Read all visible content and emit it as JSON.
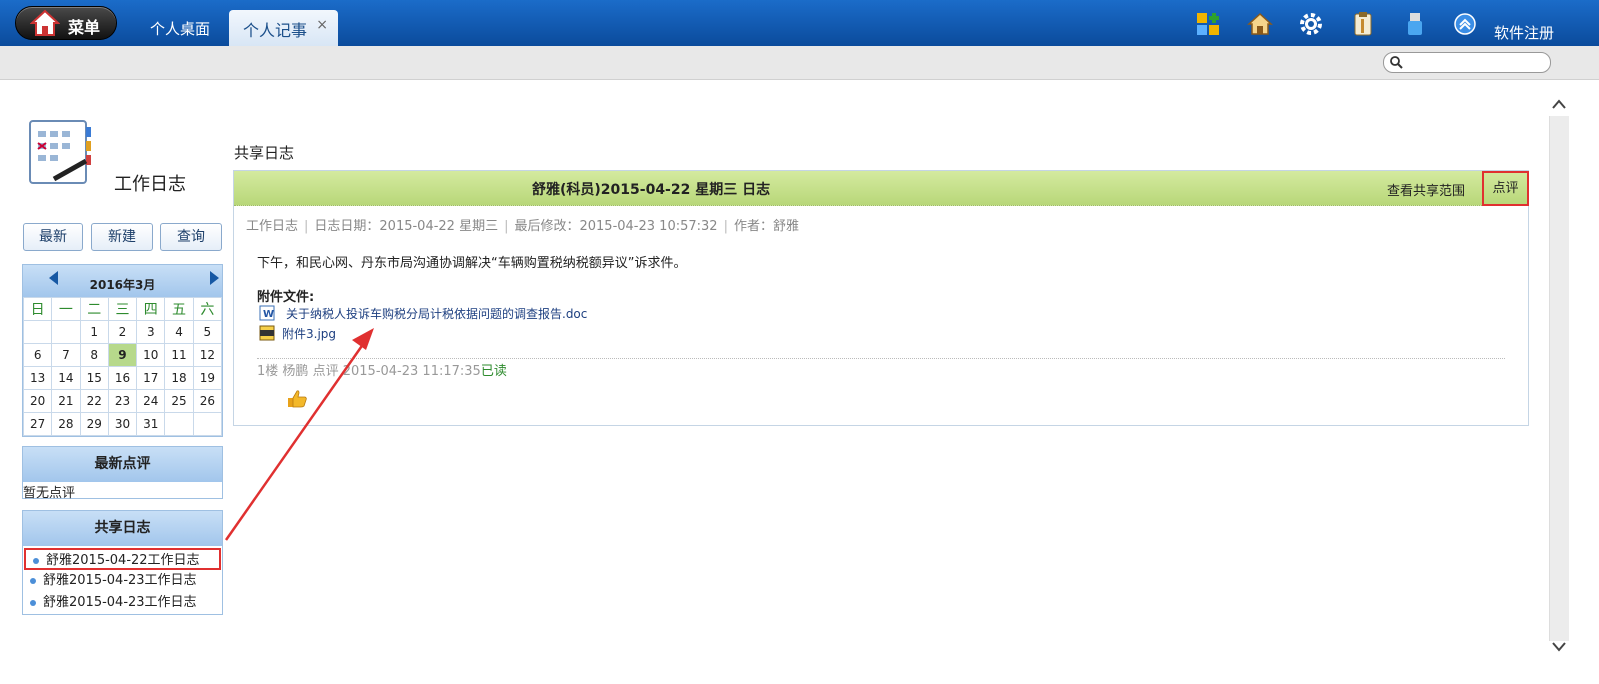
{
  "topbar": {
    "menu_label": "菜单",
    "tabs": [
      {
        "label": "个人桌面"
      },
      {
        "label": "个人记事",
        "close": "×"
      }
    ],
    "register": "软件注册",
    "icons": [
      "apps-icon",
      "home-icon",
      "settings-icon",
      "clipboard-icon",
      "usb-icon",
      "collapse-up-icon"
    ]
  },
  "search": {
    "placeholder": ""
  },
  "sidebar": {
    "title": "工作日志",
    "buttons": {
      "latest": "最新",
      "new": "新建",
      "query": "查询"
    },
    "calendar": {
      "title": "2016年3月",
      "weekdays": [
        "日",
        "一",
        "二",
        "三",
        "四",
        "五",
        "六"
      ],
      "weeks": [
        [
          "",
          "",
          "1",
          "2",
          "3",
          "4",
          "5"
        ],
        [
          "6",
          "7",
          "8",
          "9",
          "10",
          "11",
          "12"
        ],
        [
          "13",
          "14",
          "15",
          "16",
          "17",
          "18",
          "19"
        ],
        [
          "20",
          "21",
          "22",
          "23",
          "24",
          "25",
          "26"
        ],
        [
          "27",
          "28",
          "29",
          "30",
          "31",
          "",
          ""
        ]
      ],
      "today": "9"
    },
    "latest_comments": {
      "title": "最新点评",
      "empty": "暂无点评"
    },
    "shared": {
      "title": "共享日志",
      "items": [
        "舒雅2015-04-22工作日志",
        "舒雅2015-04-23工作日志",
        "舒雅2015-04-23工作日志"
      ]
    }
  },
  "content": {
    "section_title": "共享日志",
    "card": {
      "title": "舒雅(科员)2015-04-22 星期三 日志",
      "view_scope": "查看共享范围",
      "comment": "点评",
      "meta": {
        "type": "工作日志",
        "date": "日志日期：2015-04-22 星期三",
        "modified": "最后修改：2015-04-23 10:57:32",
        "author": "作者：舒雅"
      },
      "body": "下午，和民心网、丹东市局沟通协调解决“车辆购置税纳税额异议”诉求件。",
      "attachments_label": "附件文件:",
      "attachments": [
        {
          "name": "关于纳税人投诉车购税分局计税依据问题的调查报告.doc",
          "icon": "word-doc-icon"
        },
        {
          "name": "附件3.jpg",
          "icon": "jpg-file-icon"
        }
      ],
      "reply": {
        "floor": "1楼",
        "user": "杨鹏",
        "action": "点评",
        "time": "2015-04-23 11:17:35",
        "status": "已读"
      }
    }
  },
  "colors": {
    "topbar": "#0b4b9c",
    "card_header": "#c7e190",
    "panel_header": "#a9cbef",
    "highlight": "#e03030",
    "read_status": "#2e8b2e"
  }
}
